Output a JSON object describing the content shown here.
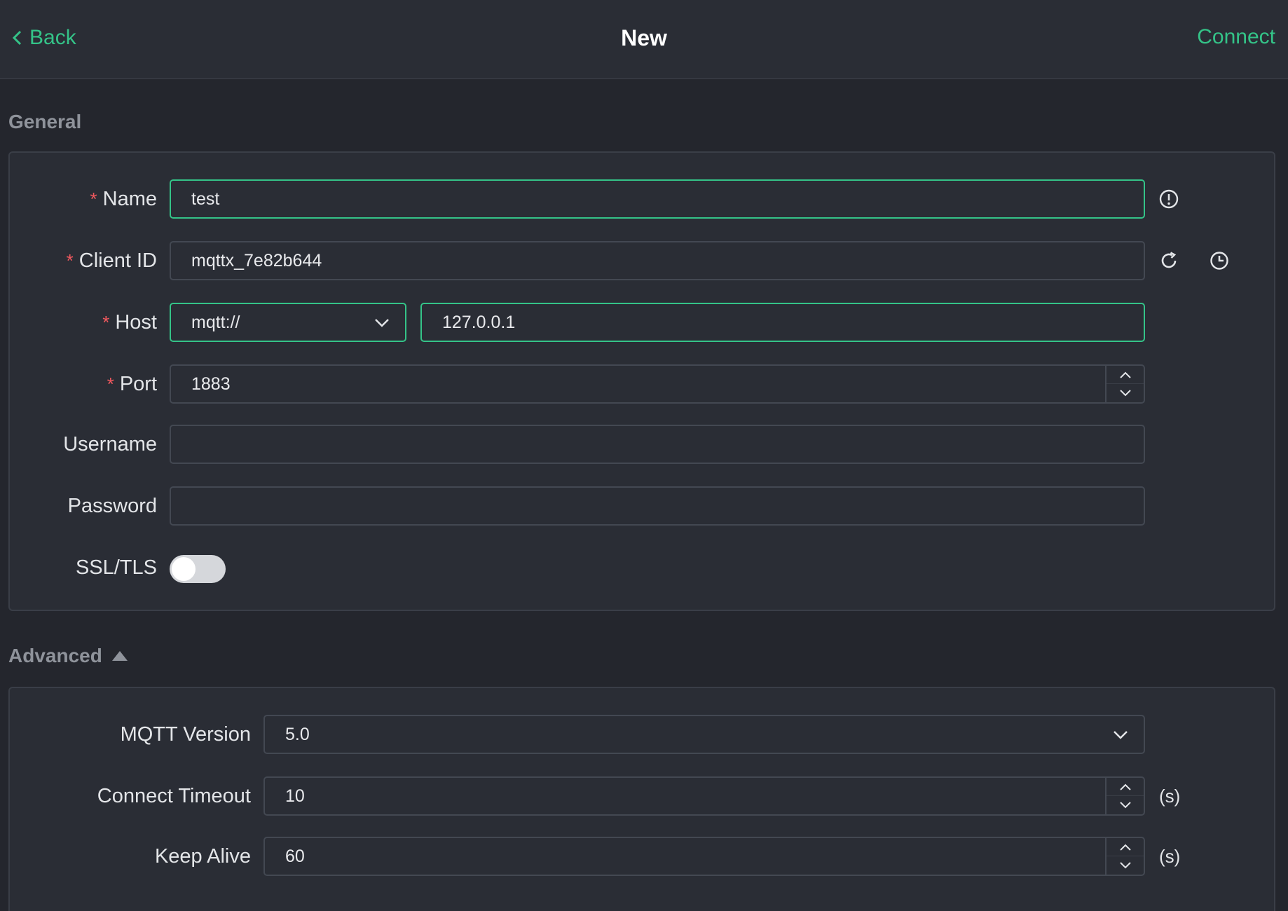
{
  "header": {
    "back_label": "Back",
    "title": "New",
    "connect_label": "Connect"
  },
  "general": {
    "title": "General",
    "name": {
      "label": "Name",
      "value": "test"
    },
    "client_id": {
      "label": "Client ID",
      "value": "mqttx_7e82b644"
    },
    "host": {
      "label": "Host",
      "protocol": "mqtt://",
      "value": "127.0.0.1"
    },
    "port": {
      "label": "Port",
      "value": "1883"
    },
    "username": {
      "label": "Username",
      "value": ""
    },
    "password": {
      "label": "Password",
      "value": ""
    },
    "ssl": {
      "label": "SSL/TLS",
      "enabled": false
    }
  },
  "advanced": {
    "title": "Advanced",
    "mqtt_version": {
      "label": "MQTT Version",
      "value": "5.0"
    },
    "connect_timeout": {
      "label": "Connect Timeout",
      "value": "10",
      "unit": "(s)"
    },
    "keep_alive": {
      "label": "Keep Alive",
      "value": "60",
      "unit": "(s)"
    }
  },
  "colors": {
    "accent": "#34c388",
    "required": "#f0585e",
    "background": "#24262d",
    "panel": "#2a2d35"
  },
  "icons": [
    "chevron-left-icon",
    "info-icon",
    "refresh-icon",
    "history-icon",
    "chevron-down-icon",
    "caret-up-icon"
  ]
}
